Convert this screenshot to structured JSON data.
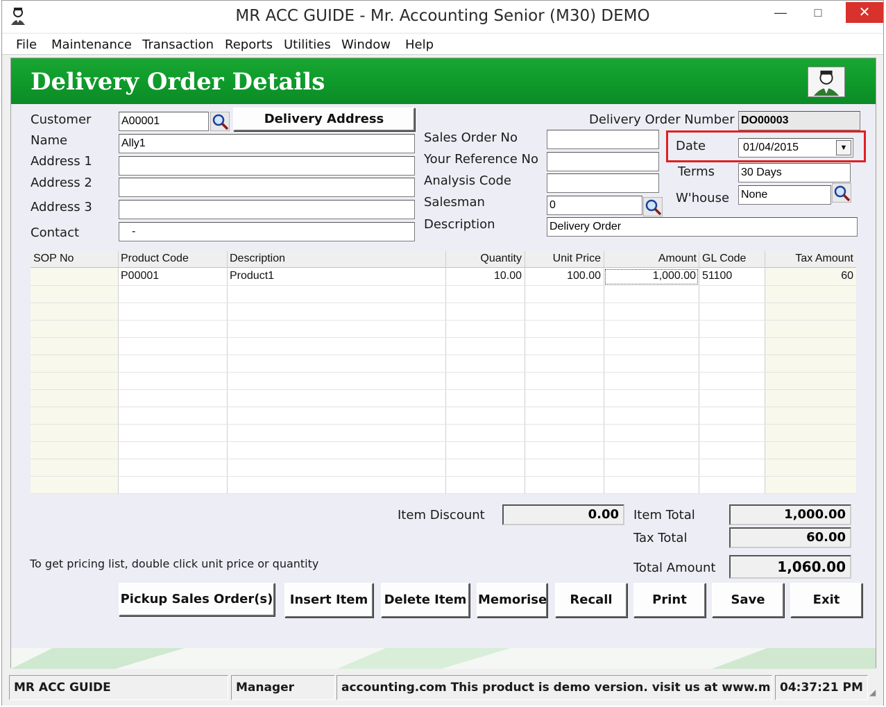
{
  "window": {
    "title": "MR ACC GUIDE - Mr. Accounting Senior (M30) DEMO",
    "min_icon": "minimize-icon",
    "max_icon": "maximize-icon",
    "close_icon": "close-icon"
  },
  "menu": [
    "File",
    "Maintenance",
    "Transaction",
    "Reports",
    "Utilities",
    "Window",
    "Help"
  ],
  "header": {
    "title": "Delivery Order Details",
    "accent": "#0e9a2a"
  },
  "customer": {
    "customer_label": "Customer",
    "customer_value": "A00001",
    "delivery_address_button": "Delivery Address",
    "name_label": "Name",
    "name_value": "Ally1",
    "address1_label": "Address 1",
    "address1_value": "",
    "address2_label": "Address 2",
    "address2_value": "",
    "address3_label": "Address 3",
    "address3_value": "",
    "contact_label": "Contact",
    "contact_value": "-"
  },
  "order": {
    "sales_order_no_label": "Sales  Order No",
    "sales_order_no_value": "",
    "your_ref_label": "Your Reference No",
    "your_ref_value": "",
    "analysis_code_label": "Analysis Code",
    "analysis_code_value": "",
    "salesman_label": "Salesman",
    "salesman_value": "0",
    "description_label": "Description",
    "description_value": "Delivery Order",
    "do_number_label": "Delivery Order Number",
    "do_number_value": "DO00003",
    "date_label": "Date",
    "date_value": "01/04/2015",
    "terms_label": "Terms",
    "terms_value": "30 Days",
    "warehouse_label": "W'house",
    "warehouse_value": "None",
    "highlight_color": "#e02020"
  },
  "grid": {
    "columns": [
      "SOP No",
      "Product Code",
      "Description",
      "Quantity",
      "Unit Price",
      "Amount",
      "GL Code",
      "Tax Amount"
    ],
    "rows": [
      {
        "sop_no": "",
        "product_code": "P00001",
        "description": "Product1",
        "quantity": "10.00",
        "unit_price": "100.00",
        "amount": "1,000.00",
        "gl_code": "51100",
        "tax_amount": "60"
      }
    ]
  },
  "totals": {
    "item_discount_label": "Item Discount",
    "item_discount_value": "0.00",
    "item_total_label": "Item Total",
    "item_total_value": "1,000.00",
    "tax_total_label": "Tax Total",
    "tax_total_value": "60.00",
    "total_amount_label": "Total Amount",
    "total_amount_value": "1,060.00"
  },
  "hint": "To get pricing list, double click unit price or quantity",
  "buttons": {
    "pickup": "Pickup Sales Order(s)",
    "insert": "Insert Item",
    "delete": "Delete Item",
    "memorise": "Memorise",
    "recall": "Recall",
    "print": "Print",
    "save": "Save",
    "exit": "Exit"
  },
  "status": {
    "company": "MR ACC GUIDE",
    "user": "Manager",
    "message": "accounting.com This product is demo version.  visit us at www.mr-",
    "time": "04:37:21 PM"
  }
}
